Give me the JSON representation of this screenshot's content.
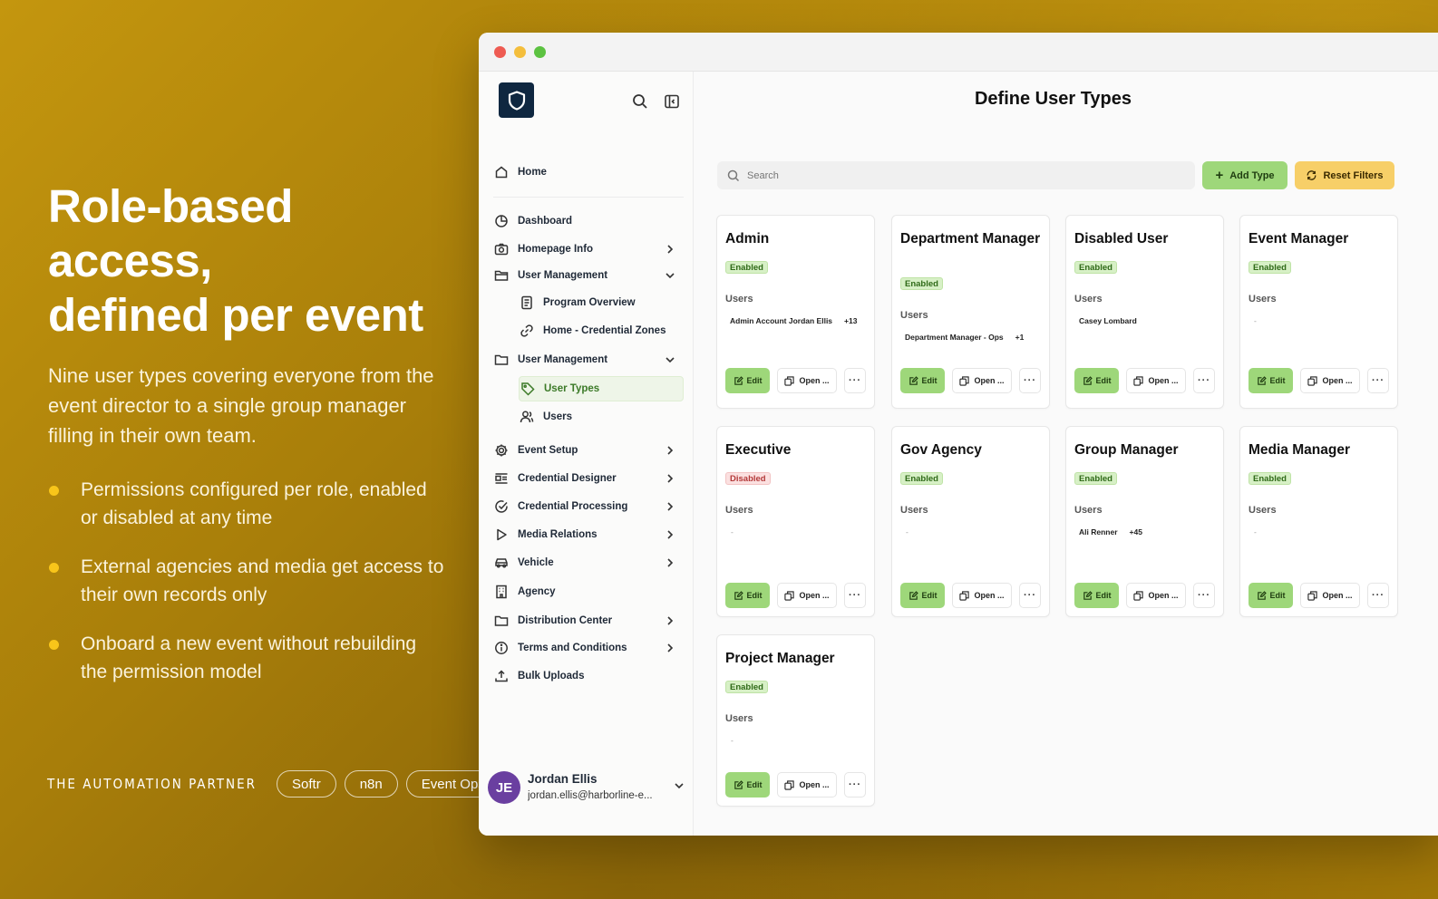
{
  "hero": {
    "title_line1": "Role-based access,",
    "title_line2": "defined per event",
    "subtitle": "Nine user types covering everyone from the event director to a single group manager filling in their own team.",
    "bullets": [
      "Permissions configured per role, enabled or disabled at any time",
      "External agencies and media get access to their own records only",
      "Onboard a new event without rebuilding the permission model"
    ]
  },
  "footer": {
    "brand": "THE AUTOMATION PARTNER",
    "tags": [
      "Softr",
      "n8n",
      "Event Ops"
    ]
  },
  "colors": {
    "accent_green": "#9ed77a",
    "accent_yellow": "#f7cf68",
    "logo_navy": "#0f2740",
    "chat_blue": "#2f80ed",
    "bullet_yellow": "#f8c51a"
  },
  "sidebar": {
    "home": "Home",
    "items": [
      {
        "label": "Dashboard",
        "icon": "pie-chart-icon"
      },
      {
        "label": "Homepage Info",
        "icon": "camera-icon"
      },
      {
        "label": "User Management",
        "icon": "folder-open-icon"
      },
      {
        "label": "Program Overview",
        "icon": "document-icon"
      },
      {
        "label": "Home - Credential Zones",
        "icon": "link-icon"
      },
      {
        "label": "User Management",
        "icon": "folder-icon"
      },
      {
        "label": "User Types",
        "icon": "tag-icon"
      },
      {
        "label": "Users",
        "icon": "users-icon"
      },
      {
        "label": "Event Setup",
        "icon": "gear-icon"
      },
      {
        "label": "Credential Designer",
        "icon": "id-card-icon"
      },
      {
        "label": "Credential Processing",
        "icon": "check-circle-icon"
      },
      {
        "label": "Media Relations",
        "icon": "play-icon"
      },
      {
        "label": "Vehicle",
        "icon": "car-icon"
      },
      {
        "label": "Agency",
        "icon": "building-icon"
      },
      {
        "label": "Distribution Center",
        "icon": "folder-icon"
      },
      {
        "label": "Terms and Conditions",
        "icon": "info-icon"
      },
      {
        "label": "Bulk Uploads",
        "icon": "upload-icon"
      }
    ],
    "user": {
      "initials": "JE",
      "name": "Jordan Ellis",
      "email": "jordan.ellis@harborline-e..."
    }
  },
  "main": {
    "title": "Define User Types",
    "search_placeholder": "Search",
    "add_label": "Add Type",
    "reset_label": "Reset Filters",
    "users_label": "Users",
    "edit_label": "Edit",
    "open_label": "Open ...",
    "more_label": "···",
    "cards": [
      {
        "title": "Admin",
        "status": "Enabled",
        "enabled": true,
        "users": "Admin Account Jordan Ellis",
        "more": "+13"
      },
      {
        "title": "Department Manager",
        "status": "Enabled",
        "enabled": true,
        "users": "Department Manager - Ops",
        "more": "+1"
      },
      {
        "title": "Disabled User",
        "status": "Enabled",
        "enabled": true,
        "users": "Casey Lombard",
        "more": ""
      },
      {
        "title": "Event Manager",
        "status": "Enabled",
        "enabled": true,
        "users": "-",
        "more": ""
      },
      {
        "title": "Executive",
        "status": "Disabled",
        "enabled": false,
        "users": "-",
        "more": ""
      },
      {
        "title": "Gov Agency",
        "status": "Enabled",
        "enabled": true,
        "users": "-",
        "more": ""
      },
      {
        "title": "Group Manager",
        "status": "Enabled",
        "enabled": true,
        "users": "Ali Renner",
        "more": "+45"
      },
      {
        "title": "Media Manager",
        "status": "Enabled",
        "enabled": true,
        "users": "-",
        "more": ""
      },
      {
        "title": "Project Manager",
        "status": "Enabled",
        "enabled": true,
        "users": "-",
        "more": ""
      }
    ]
  }
}
